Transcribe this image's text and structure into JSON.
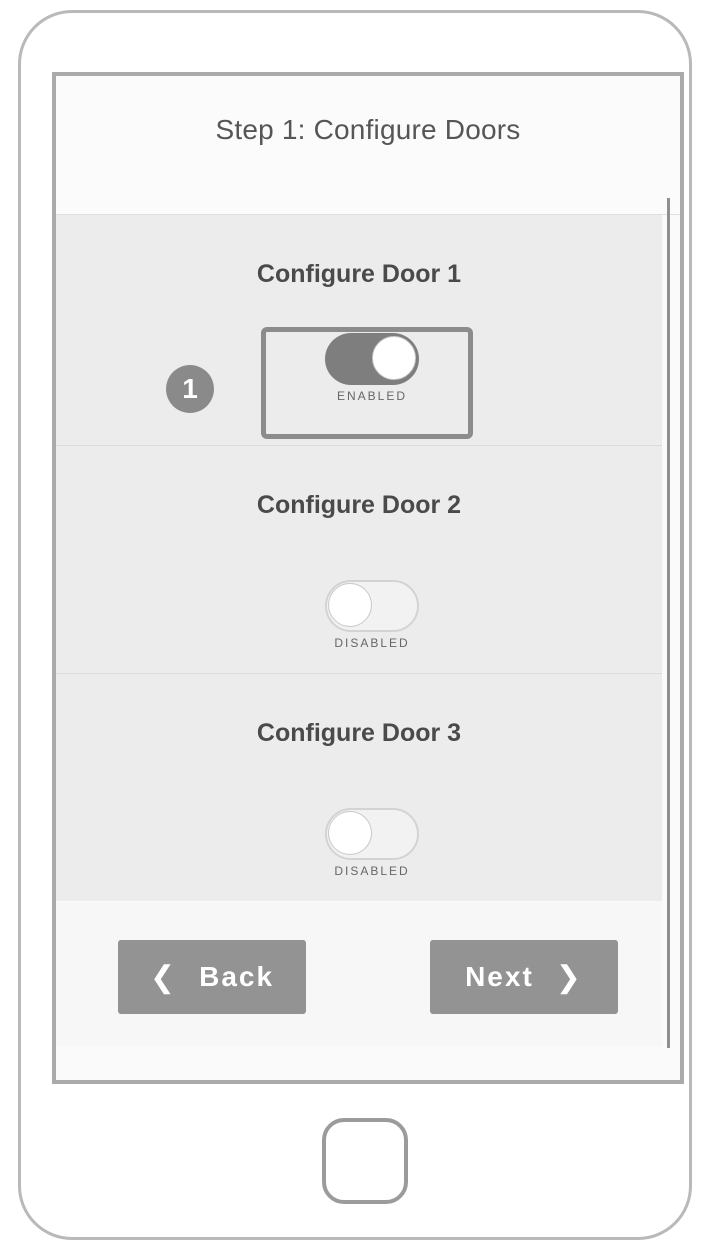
{
  "header": {
    "title": "Step 1: Configure Doors"
  },
  "doors": [
    {
      "title": "Configure Door 1",
      "state": "ENABLED",
      "enabled": true,
      "step_badge": "1"
    },
    {
      "title": "Configure Door 2",
      "state": "DISABLED",
      "enabled": false
    },
    {
      "title": "Configure Door 3",
      "state": "DISABLED",
      "enabled": false
    }
  ],
  "footer": {
    "back_label": "Back",
    "next_label": "Next"
  },
  "icons": {
    "back": "chevron-left-icon",
    "next": "chevron-right-icon"
  },
  "colors": {
    "button": "#939393",
    "toggle_on": "#7e7e7e",
    "section_bg": "#ececec"
  }
}
